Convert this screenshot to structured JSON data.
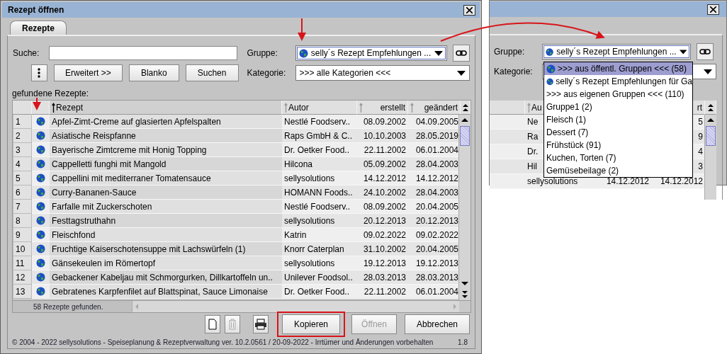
{
  "window": {
    "title": "Rezept öffnen"
  },
  "tabs": [
    {
      "label": "Rezepte",
      "selected": true
    }
  ],
  "search": {
    "label": "Suche:"
  },
  "search_buttons": [
    "Erweitert >>",
    "Blanko",
    "Suchen"
  ],
  "group": {
    "label": "Gruppe:",
    "value": "selly´s  Rezept Empfehlungen ..."
  },
  "category": {
    "label": "Kategorie:",
    "value": ">>> alle Kategorien <<<"
  },
  "results_label": "gefundene Rezepte:",
  "table": {
    "columns": [
      {
        "label": "Rezept",
        "sorted": true
      },
      {
        "label": "Autor",
        "sorted": false
      },
      {
        "label": "erstellt",
        "sorted": false
      },
      {
        "label": "geändert",
        "sorted": false
      }
    ],
    "rows": [
      {
        "number": "1",
        "recipe": "Apfel-Zimt-Creme auf glasierten Apfelspalten",
        "author": "Nestlé Foodserv..",
        "created": "08.09.2002",
        "changed": "04.09.2005"
      },
      {
        "number": "2",
        "recipe": "Asiatische Reispfanne",
        "author": "Raps GmbH & C..",
        "created": "10.10.2003",
        "changed": "28.05.2019"
      },
      {
        "number": "3",
        "recipe": "Bayerische Zimtcreme mit Honig Topping",
        "author": "Dr. Oetker Food..",
        "created": "22.11.2002",
        "changed": "06.01.2004"
      },
      {
        "number": "4",
        "recipe": "Cappelletti funghi mit Mangold",
        "author": "Hilcona",
        "created": "05.09.2002",
        "changed": "28.04.2003"
      },
      {
        "number": "5",
        "recipe": "Cappellini mit mediterraner Tomatensauce",
        "author": "sellysolutions",
        "created": "14.12.2012",
        "changed": "14.12.2012"
      },
      {
        "number": "6",
        "recipe": "Curry-Bananen-Sauce",
        "author": "HOMANN Foods..",
        "created": "24.10.2002",
        "changed": "28.04.2003"
      },
      {
        "number": "7",
        "recipe": "Farfalle mit Zuckerschoten",
        "author": "Nestlé Foodserv..",
        "created": "08.09.2002",
        "changed": "20.04.2005"
      },
      {
        "number": "8",
        "recipe": "Festtagstruthahn",
        "author": "sellysolutions",
        "created": "20.12.2013",
        "changed": "20.12.2013"
      },
      {
        "number": "9",
        "recipe": "Fleischfond",
        "author": "Katrin",
        "created": "09.02.2022",
        "changed": "09.02.2022"
      },
      {
        "number": "10",
        "recipe": "Fruchtige Kaiserschotensuppe mit Lachswürfeln (1)",
        "author": "Knorr Caterplan",
        "created": "31.10.2002",
        "changed": "20.04.2005"
      },
      {
        "number": "11",
        "recipe": "Gänsekeulen im Römertopf",
        "author": "sellysolutions",
        "created": "19.12.2013",
        "changed": "19.12.2013"
      },
      {
        "number": "12",
        "recipe": "Gebackener Kabeljau mit Schmorgurken, Dillkartoffeln un..",
        "author": "Unilever Foodsol..",
        "created": "28.03.2013",
        "changed": "28.03.2013"
      },
      {
        "number": "13",
        "recipe": "Gebratenes Karpfenfilet auf Blattspinat, Sauce Limonaise",
        "author": "Dr. Oetker Food..",
        "created": "22.11.2002",
        "changed": "06.01.2004"
      }
    ]
  },
  "status": "58  Rezepte gefunden.",
  "icon_buttons": [
    {
      "kind": "new",
      "disabled": false
    },
    {
      "kind": "delete",
      "disabled": true
    },
    {
      "kind": "print",
      "disabled": false
    }
  ],
  "actions": [
    {
      "label": "Kopieren",
      "disabled": false,
      "highlighted": true
    },
    {
      "label": "Öffnen",
      "disabled": true,
      "highlighted": false
    },
    {
      "label": "Abbrechen",
      "disabled": false,
      "highlighted": false
    }
  ],
  "footer": {
    "text": "© 2004 - 2022 sellysolutions - Speiseplanung & Rezeptverwaltung ver. 10.2.0561 / 20-09-2022 - Irrtümer und Änderungen vorbehalten",
    "version": "1.8"
  },
  "dropdown_view": {
    "group_label": "Gruppe:",
    "group_value": "selly´s  Rezept Empfehlungen ...",
    "category_label": "Kategorie:",
    "options": [
      {
        "label": ">>> aus öffentl. Gruppen <<< (58)",
        "public": true,
        "selected": true
      },
      {
        "label": "selly´s  Rezept Empfehlungen für Ga",
        "public": true,
        "selected": false
      },
      {
        "label": ">>> aus eigenen Gruppen <<< (110)",
        "public": false,
        "selected": false
      },
      {
        "label": "Gruppe1 (2)",
        "public": false,
        "selected": false
      },
      {
        "label": "Fleisch (1)",
        "public": false,
        "selected": false
      },
      {
        "label": "Dessert (7)",
        "public": false,
        "selected": false
      },
      {
        "label": "Frühstück (91)",
        "public": false,
        "selected": false
      },
      {
        "label": "Kuchen, Torten (7)",
        "public": false,
        "selected": false
      },
      {
        "label": "Gemüsebeilage (2)",
        "public": false,
        "selected": false
      }
    ],
    "columns": [
      "Au",
      "rt"
    ],
    "rows": [
      {
        "author": "Ne",
        "changed": "5"
      },
      {
        "author": "Ra",
        "changed": "9"
      },
      {
        "author": "Dr.",
        "changed": "4"
      },
      {
        "author": "Hil",
        "changed": "3"
      },
      {
        "author": "sellysolutions",
        "created": "14.12.2012",
        "changed": "14.12.2012"
      }
    ]
  }
}
